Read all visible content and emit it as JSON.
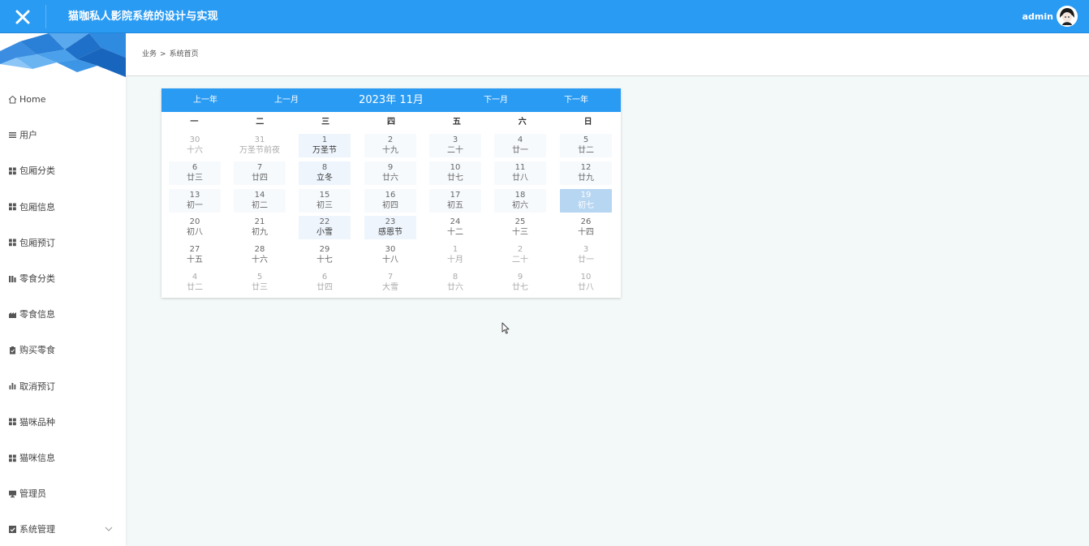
{
  "header": {
    "title": "猫咖私人影院系统的设计与实现",
    "username": "admin",
    "close_icon": "close-icon",
    "brand_color": "#2a9bf3"
  },
  "sidebar": {
    "items": [
      {
        "label": "Home",
        "icon": "home-icon"
      },
      {
        "label": "用户",
        "icon": "list-icon"
      },
      {
        "label": "包厢分类",
        "icon": "grid-icon"
      },
      {
        "label": "包厢信息",
        "icon": "grid-icon"
      },
      {
        "label": "包厢预订",
        "icon": "grid-icon"
      },
      {
        "label": "零食分类",
        "icon": "bars-icon"
      },
      {
        "label": "零食信息",
        "icon": "shop-icon"
      },
      {
        "label": "购买零食",
        "icon": "clipboard-icon"
      },
      {
        "label": "取消预订",
        "icon": "chart-icon"
      },
      {
        "label": "猫咪品种",
        "icon": "grid-icon"
      },
      {
        "label": "猫咪信息",
        "icon": "grid-icon"
      },
      {
        "label": "管理员",
        "icon": "monitor-icon"
      },
      {
        "label": "系统管理",
        "icon": "check-square-icon",
        "has_children": true
      }
    ]
  },
  "breadcrumb": {
    "parent": "业务",
    "separator": ">",
    "current": "系统首页"
  },
  "calendar": {
    "prev_year": "上一年",
    "prev_month": "上一月",
    "year_month": "2023年 11月",
    "next_month": "下一月",
    "next_year": "下一年",
    "weekdays": [
      "一",
      "二",
      "三",
      "四",
      "五",
      "六",
      "日"
    ],
    "weeks": [
      [
        {
          "day": "30",
          "lunar": "十六",
          "other": true
        },
        {
          "day": "31",
          "lunar": "万圣节前夜",
          "other": true
        },
        {
          "day": "1",
          "lunar": "万圣节",
          "festival": true
        },
        {
          "day": "2",
          "lunar": "十九",
          "faint": true
        },
        {
          "day": "3",
          "lunar": "二十",
          "faint": true
        },
        {
          "day": "4",
          "lunar": "廿一",
          "faint": true
        },
        {
          "day": "5",
          "lunar": "廿二",
          "faint": true
        }
      ],
      [
        {
          "day": "6",
          "lunar": "廿三",
          "faint": true
        },
        {
          "day": "7",
          "lunar": "廿四",
          "faint": true
        },
        {
          "day": "8",
          "lunar": "立冬",
          "festival": true
        },
        {
          "day": "9",
          "lunar": "廿六",
          "faint": true
        },
        {
          "day": "10",
          "lunar": "廿七",
          "faint": true
        },
        {
          "day": "11",
          "lunar": "廿八",
          "faint": true
        },
        {
          "day": "12",
          "lunar": "廿九",
          "faint": true
        }
      ],
      [
        {
          "day": "13",
          "lunar": "初一",
          "faint": true
        },
        {
          "day": "14",
          "lunar": "初二",
          "faint": true
        },
        {
          "day": "15",
          "lunar": "初三",
          "faint": true
        },
        {
          "day": "16",
          "lunar": "初四",
          "faint": true
        },
        {
          "day": "17",
          "lunar": "初五",
          "faint": true
        },
        {
          "day": "18",
          "lunar": "初六",
          "faint": true
        },
        {
          "day": "19",
          "lunar": "初七",
          "today": true
        }
      ],
      [
        {
          "day": "20",
          "lunar": "初八"
        },
        {
          "day": "21",
          "lunar": "初九"
        },
        {
          "day": "22",
          "lunar": "小雪",
          "festival": true
        },
        {
          "day": "23",
          "lunar": "感恩节",
          "festival": true
        },
        {
          "day": "24",
          "lunar": "十二"
        },
        {
          "day": "25",
          "lunar": "十三"
        },
        {
          "day": "26",
          "lunar": "十四"
        }
      ],
      [
        {
          "day": "27",
          "lunar": "十五"
        },
        {
          "day": "28",
          "lunar": "十六"
        },
        {
          "day": "29",
          "lunar": "十七"
        },
        {
          "day": "30",
          "lunar": "十八"
        },
        {
          "day": "1",
          "lunar": "十月",
          "other": true
        },
        {
          "day": "2",
          "lunar": "二十",
          "other": true
        },
        {
          "day": "3",
          "lunar": "廿一",
          "other": true
        }
      ],
      [
        {
          "day": "4",
          "lunar": "廿二",
          "other": true
        },
        {
          "day": "5",
          "lunar": "廿三",
          "other": true
        },
        {
          "day": "6",
          "lunar": "廿四",
          "other": true
        },
        {
          "day": "7",
          "lunar": "大雪",
          "other": true
        },
        {
          "day": "8",
          "lunar": "廿六",
          "other": true
        },
        {
          "day": "9",
          "lunar": "廿七",
          "other": true
        },
        {
          "day": "10",
          "lunar": "廿八",
          "other": true
        }
      ]
    ]
  }
}
